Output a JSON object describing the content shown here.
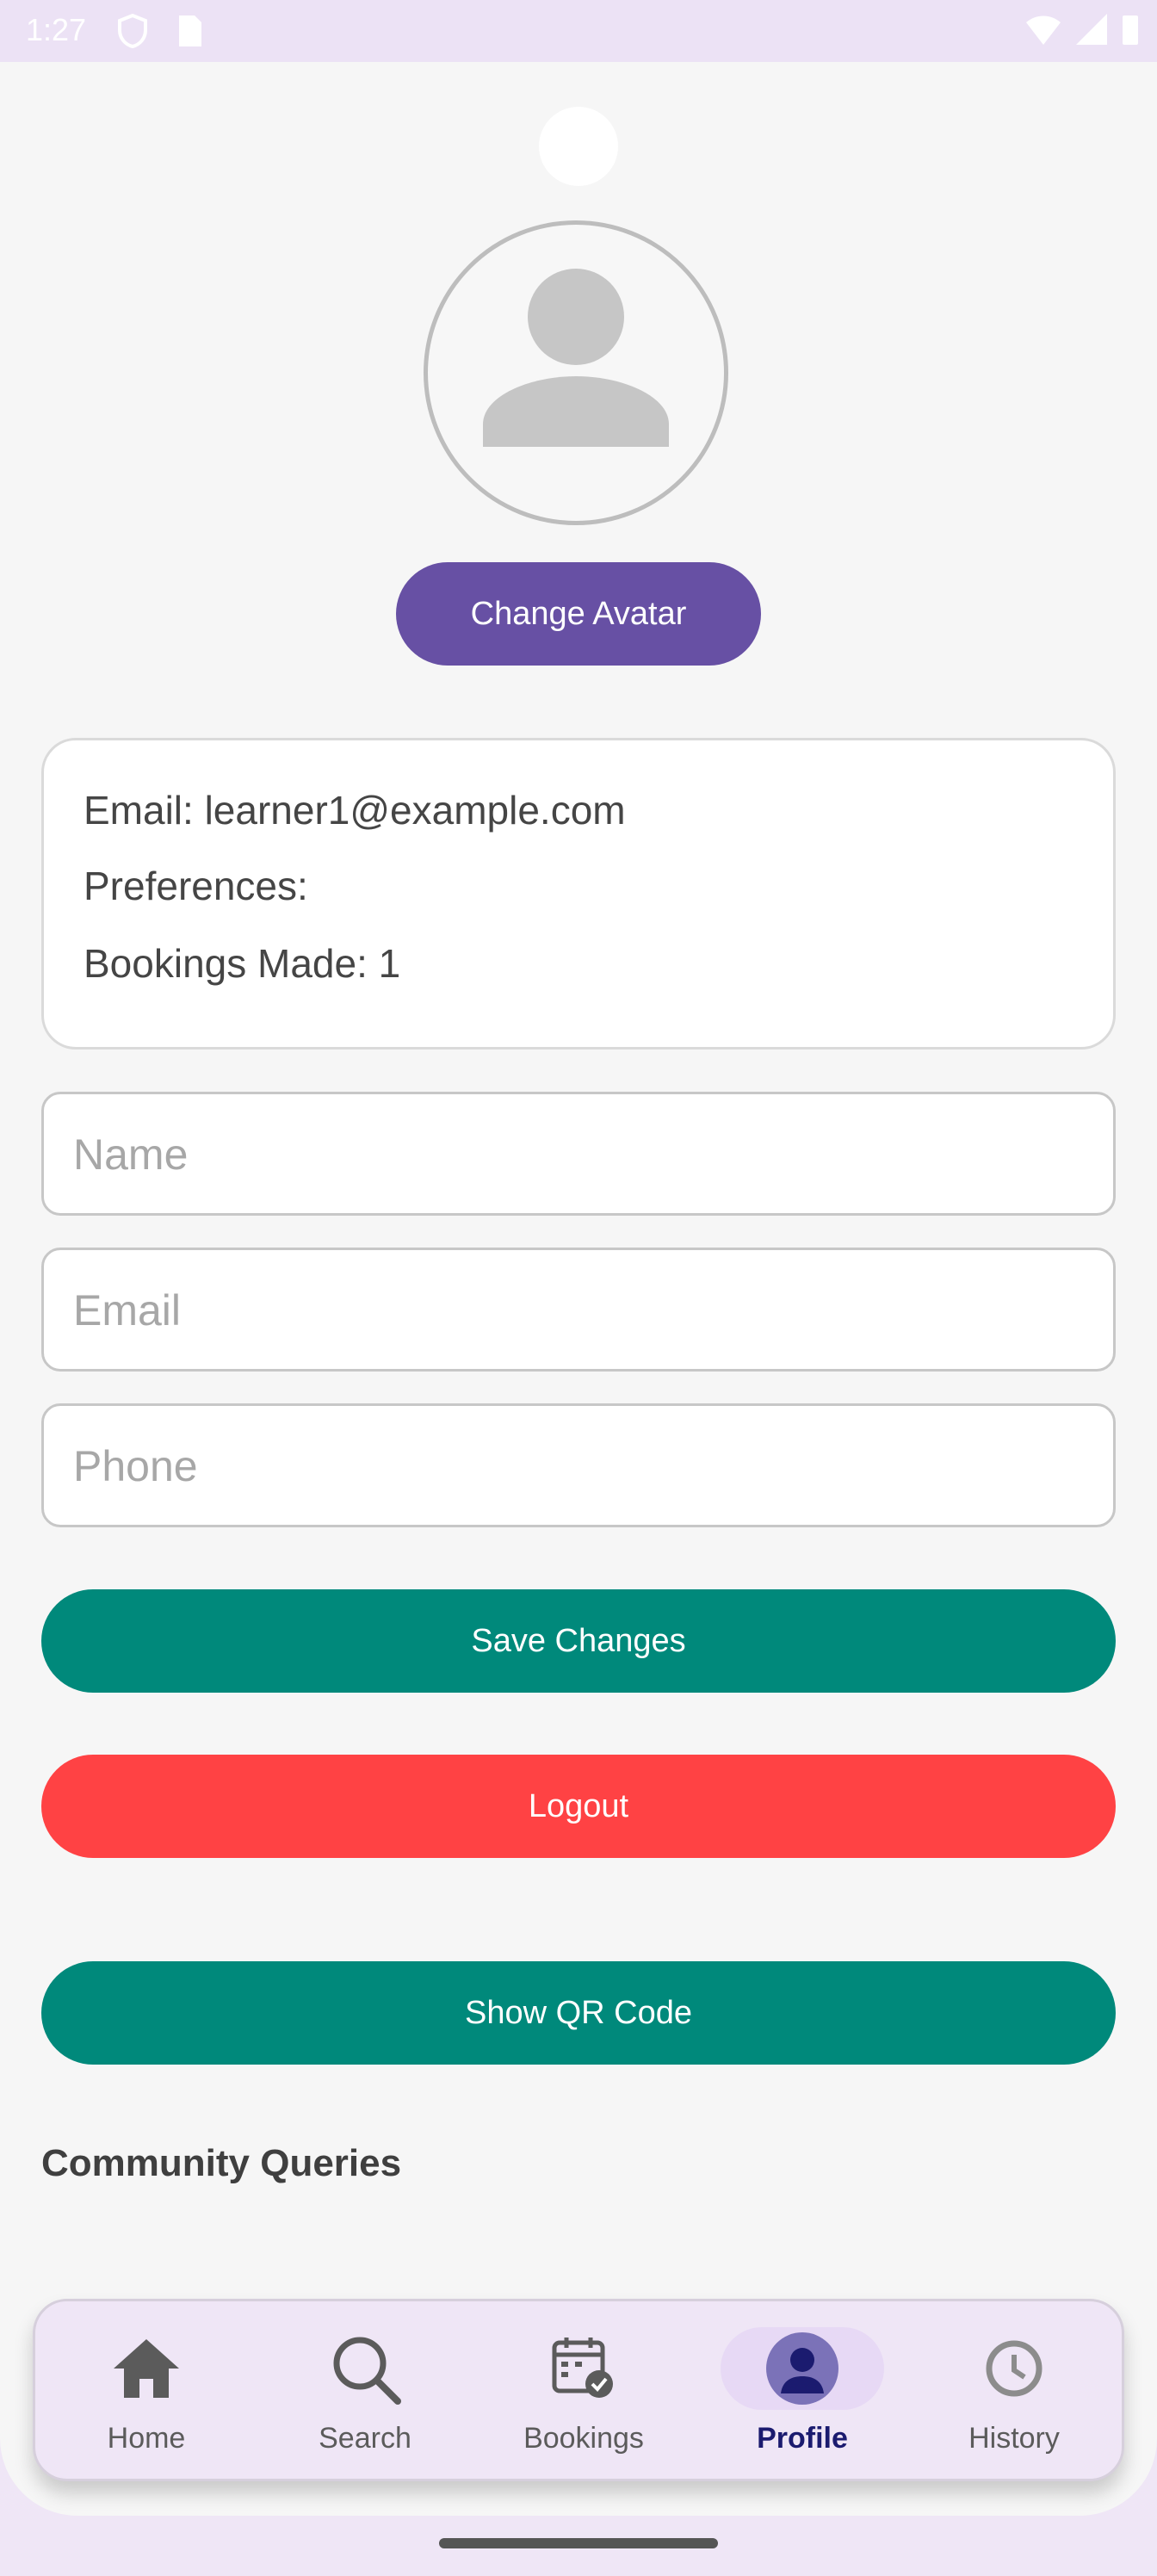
{
  "status_bar": {
    "time": "1:27",
    "icons": [
      "shield-icon",
      "sim-card-icon",
      "wifi-icon",
      "signal-icon",
      "battery-icon"
    ]
  },
  "profile": {
    "avatar_icon": "person-avatar-icon",
    "change_avatar_label": "Change Avatar"
  },
  "info": {
    "email_line": "Email: learner1@example.com",
    "preferences_line": "Preferences:",
    "bookings_line": "Bookings Made: 1"
  },
  "form": {
    "name_placeholder": "Name",
    "email_placeholder": "Email",
    "phone_placeholder": "Phone"
  },
  "actions": {
    "save_label": "Save Changes",
    "logout_label": "Logout",
    "qr_label": "Show QR Code"
  },
  "community": {
    "title": "Community Queries"
  },
  "nav": {
    "items": [
      {
        "label": "Home",
        "icon": "home-icon"
      },
      {
        "label": "Search",
        "icon": "search-icon"
      },
      {
        "label": "Bookings",
        "icon": "calendar-check-icon"
      },
      {
        "label": "Profile",
        "icon": "person-icon",
        "active": true
      },
      {
        "label": "History",
        "icon": "clock-icon"
      }
    ]
  },
  "colors": {
    "primary": "#6750a4",
    "teal": "#00897b",
    "danger": "#ff4244",
    "nav_bg": "#efe6f6",
    "nav_active": "#1b1b6f"
  }
}
